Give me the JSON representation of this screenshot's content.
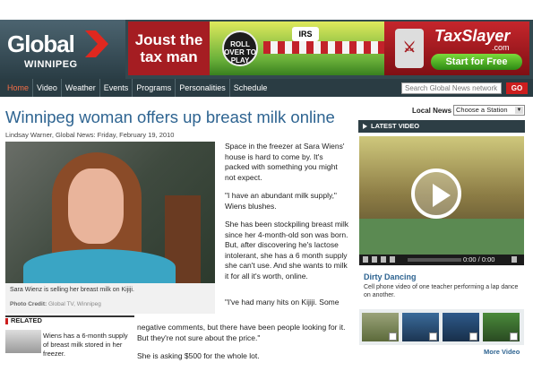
{
  "header": {
    "logo_main": "Global",
    "logo_city": "WINNIPEG",
    "banner_left": "Joust the tax man",
    "banner_rollover": "ROLL OVER TO PLAY",
    "banner_irs": "IRS",
    "banner_brand": "TaxSlayer",
    "banner_brand_suffix": ".com",
    "banner_cta": "Start for Free"
  },
  "nav": {
    "items": [
      "Home",
      "Video",
      "Weather",
      "Events",
      "Programs",
      "Personalities",
      "Schedule"
    ],
    "active": "Home",
    "search_placeholder": "Search Global News network",
    "go_label": "GO"
  },
  "article": {
    "headline": "Winnipeg woman offers up breast milk online",
    "byline": "Lindsay Warner, Global News: Friday, February 19, 2010",
    "photo_caption": "Sara Wienz is selling her breast milk on Kijiji.",
    "photo_credit_label": "Photo Credit:",
    "photo_credit": "Global TV, Winnipeg",
    "paragraphs": [
      "Space in the freezer at Sara Wiens' house is hard to come by. It's packed with something you might not expect.",
      "\"I have an abundant milk supply,\" Wiens blushes.",
      "She has been stockpiling breast milk since her 4-month-old son was born. But, after discovering he's lactose intolerant, she has a 6 month supply she can't use. And she wants to milk it for all it's worth, online.",
      "\"I've had many hits on Kijiji. Some negative comments, but there have been people looking for it. But they're not sure about the price.\"",
      "She is asking $500 for the whole lot."
    ],
    "p4_first": "\"I've had many hits on Kijiji. Some",
    "p4_rest": "negative comments, but there have been people looking for it. But they're not sure about the price.\""
  },
  "related": {
    "heading": "RELATED",
    "item_text": "Wiens has a 6-month supply of breast milk stored in her freezer."
  },
  "sidebar": {
    "local_news_label": "Local News",
    "station_select": "Choose a Station",
    "latest_video_heading": "LATEST VIDEO",
    "video_time": "0:00 / 0:00",
    "video_title": "Dirty Dancing",
    "video_desc": "Cell phone video of one teacher performing a lap dance on another.",
    "more_video": "More Video"
  },
  "colors": {
    "headline_blue": "#2e6491",
    "nav_active": "#f36e46",
    "header_dark": "#33484f",
    "go_red": "#cc1e1e"
  }
}
